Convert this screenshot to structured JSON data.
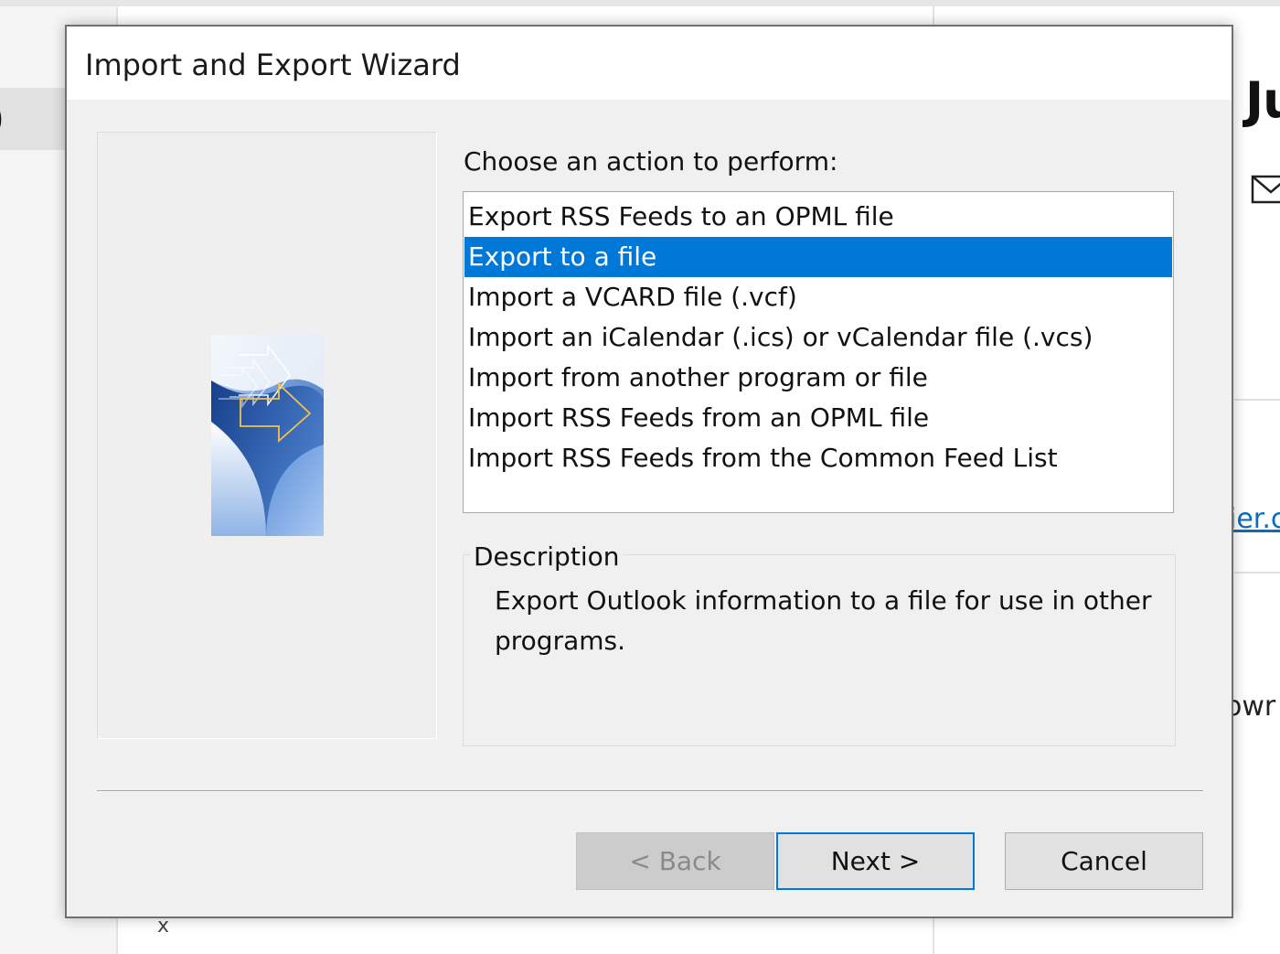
{
  "background_app": {
    "left_glyph": ")",
    "heading_fragment": "Ju",
    "link_fragment": "ier.c",
    "text_fragment": "owr",
    "bottom_mark": "x",
    "mail_icon": "envelope-icon"
  },
  "dialog": {
    "title": "Import and Export Wizard",
    "choose_label": "Choose an action to perform:",
    "actions": [
      {
        "label": "Export RSS Feeds to an OPML file",
        "selected": false
      },
      {
        "label": "Export to a file",
        "selected": true
      },
      {
        "label": "Import a VCARD file (.vcf)",
        "selected": false
      },
      {
        "label": "Import an iCalendar (.ics) or vCalendar file (.vcs)",
        "selected": false
      },
      {
        "label": "Import from another program or file",
        "selected": false
      },
      {
        "label": "Import RSS Feeds from an OPML file",
        "selected": false
      },
      {
        "label": "Import RSS Feeds from the Common Feed List",
        "selected": false
      }
    ],
    "description_title": "Description",
    "description_text": "Export Outlook information to a file for use in other programs.",
    "buttons": {
      "back": "< Back",
      "next": "Next >",
      "cancel": "Cancel"
    },
    "graphic_icon": "wizard-arrows-graphic"
  },
  "colors": {
    "selection": "#0078d7",
    "dialog_bg": "#f0f0f0",
    "link": "#0f6cbd"
  }
}
